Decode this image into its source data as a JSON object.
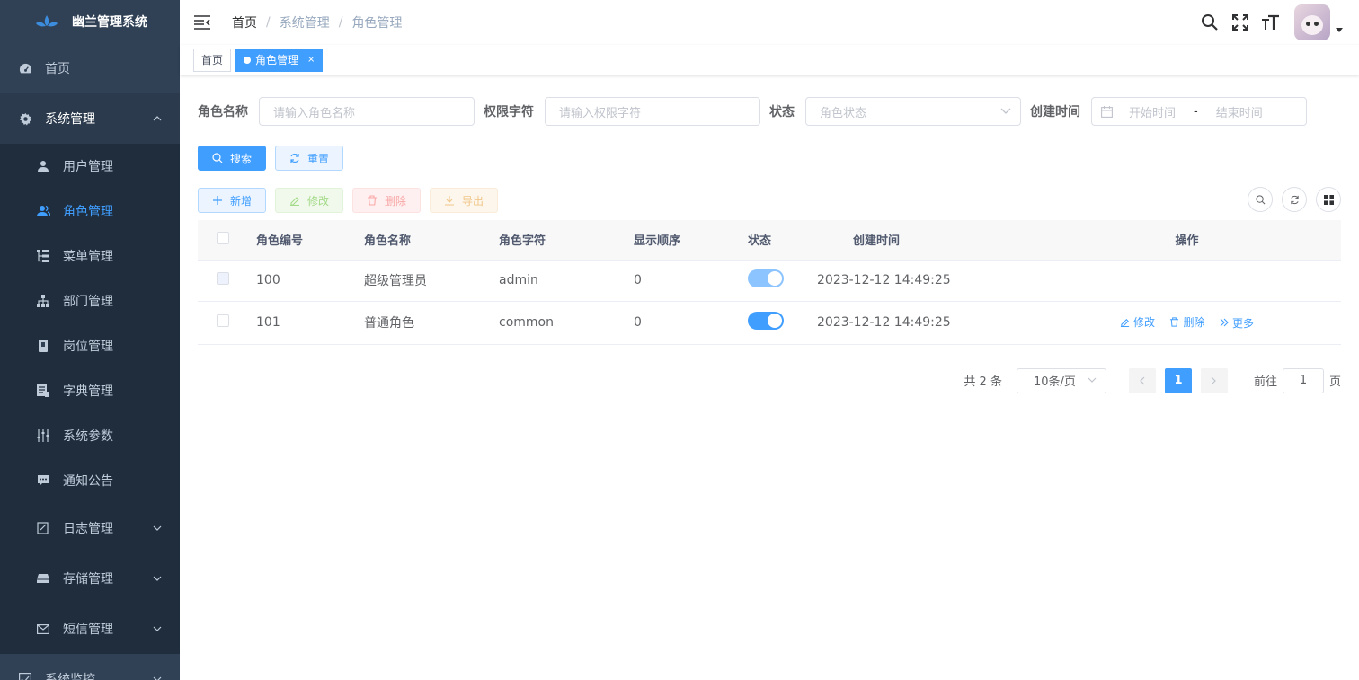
{
  "app": {
    "title": "幽兰管理系统"
  },
  "sidebar": {
    "home": "首页",
    "system": "系统管理",
    "sub_items": [
      {
        "label": "用户管理",
        "icon": "user-icon"
      },
      {
        "label": "角色管理",
        "icon": "peoples-icon"
      },
      {
        "label": "菜单管理",
        "icon": "tree-table-icon"
      },
      {
        "label": "部门管理",
        "icon": "tree-icon"
      },
      {
        "label": "岗位管理",
        "icon": "post-icon"
      },
      {
        "label": "字典管理",
        "icon": "dict-icon"
      },
      {
        "label": "系统参数",
        "icon": "edit-icon"
      },
      {
        "label": "通知公告",
        "icon": "message-icon"
      }
    ],
    "log": "日志管理",
    "storage": "存储管理",
    "sms": "短信管理",
    "monitor": "系统监控"
  },
  "breadcrumb": [
    "首页",
    "系统管理",
    "角色管理"
  ],
  "tags": {
    "home": "首页",
    "active": "角色管理",
    "close": "×"
  },
  "search": {
    "role_name_label": "角色名称",
    "role_name_placeholder": "请输入角色名称",
    "role_key_label": "权限字符",
    "role_key_placeholder": "请输入权限字符",
    "status_label": "状态",
    "status_placeholder": "角色状态",
    "created_label": "创建时间",
    "start_placeholder": "开始时间",
    "date_sep": "-",
    "end_placeholder": "结束时间",
    "search_btn": "搜索",
    "reset_btn": "重置"
  },
  "toolbar": {
    "add": "新增",
    "edit": "修改",
    "delete": "删除",
    "export": "导出"
  },
  "table": {
    "headers": [
      "角色编号",
      "角色名称",
      "角色字符",
      "显示顺序",
      "状态",
      "创建时间",
      "操作"
    ],
    "rows": [
      {
        "id": "100",
        "name": "超级管理员",
        "key": "admin",
        "sort": "0",
        "status_on": true,
        "created": "2023-12-12 14:49:25"
      },
      {
        "id": "101",
        "name": "普通角色",
        "key": "common",
        "sort": "0",
        "status_on": true,
        "created": "2023-12-12 14:49:25"
      }
    ],
    "ops": {
      "edit": "修改",
      "delete": "删除",
      "more": "更多"
    }
  },
  "pagination": {
    "total": "共 2 条",
    "size": "10条/页",
    "current": "1",
    "goto_label": "前往",
    "goto_value": "1",
    "page_suffix": "页"
  },
  "colors": {
    "primary": "#409eff",
    "sidebar": "#304156",
    "submenu": "#1f2d3d"
  }
}
